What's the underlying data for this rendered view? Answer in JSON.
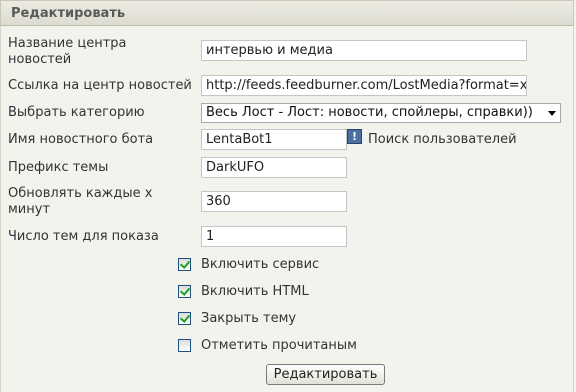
{
  "header": {
    "title": "Редактировать"
  },
  "fields": {
    "name": {
      "label": "Название центра новостей",
      "value": "интервью и медиа"
    },
    "url": {
      "label": "Ссылка на центр новостей",
      "value": "http://feeds.feedburner.com/LostMedia?format=xml"
    },
    "category": {
      "label": "Выбрать категорию",
      "selected": "Весь Лост - Лост: новости, спойлеры, справки))"
    },
    "bot": {
      "label": "Имя новостного бота",
      "value": "LentaBot1",
      "search_label": "Поиск пользователей"
    },
    "prefix": {
      "label": "Префикс темы",
      "value": "DarkUFO"
    },
    "interval": {
      "label": "Обновлять каждые x минут",
      "value": "360"
    },
    "topics": {
      "label": "Число тем для показа",
      "value": "1"
    }
  },
  "checkboxes": [
    {
      "label": "Включить сервис",
      "checked": true
    },
    {
      "label": "Включить HTML",
      "checked": true
    },
    {
      "label": "Закрыть тему",
      "checked": true
    },
    {
      "label": "Отметить прочитаным",
      "checked": false
    }
  ],
  "submit_label": "Редактировать"
}
